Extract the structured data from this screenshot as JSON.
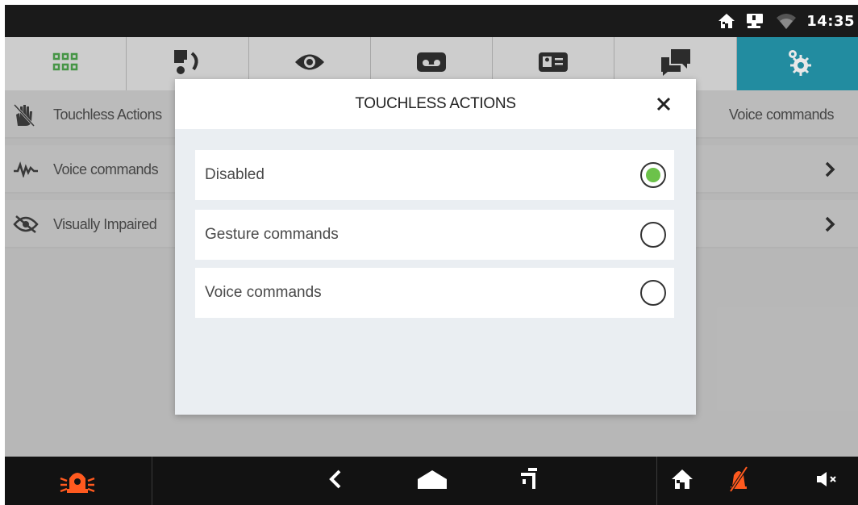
{
  "statusbar": {
    "time": "14:35",
    "icons": [
      "home-icon",
      "network-device-icon",
      "wifi-icon"
    ]
  },
  "tabs": [
    {
      "name": "apps-grid-icon",
      "color": "#3a9a3a"
    },
    {
      "name": "intercom-call-icon"
    },
    {
      "name": "eye-icon"
    },
    {
      "name": "voicemail-icon"
    },
    {
      "name": "contact-card-icon"
    },
    {
      "name": "chat-icon"
    },
    {
      "name": "settings-gear-icon",
      "active": true,
      "color": "#0e8fa8"
    }
  ],
  "settings_list": {
    "items": [
      {
        "label": "Touchless Actions",
        "value": "Voice commands",
        "icon": "touchless-hand-icon"
      },
      {
        "label": "Voice commands",
        "icon": "voice-wave-icon"
      },
      {
        "label": "Visually Impaired",
        "icon": "eye-crossed-icon"
      }
    ]
  },
  "modal": {
    "title": "TOUCHLESS ACTIONS",
    "options": [
      {
        "label": "Disabled",
        "selected": true
      },
      {
        "label": "Gesture commands",
        "selected": false
      },
      {
        "label": "Voice commands",
        "selected": false
      }
    ],
    "selected_color": "#6cc24a"
  },
  "navbar": {
    "icons": [
      "alarm-siren-icon",
      "back-icon",
      "home-nav-icon",
      "recent-apps-icon",
      "home-status-icon",
      "muted-bell-icon",
      "speaker-mute-icon"
    ],
    "accent": "#ff5a1f"
  }
}
